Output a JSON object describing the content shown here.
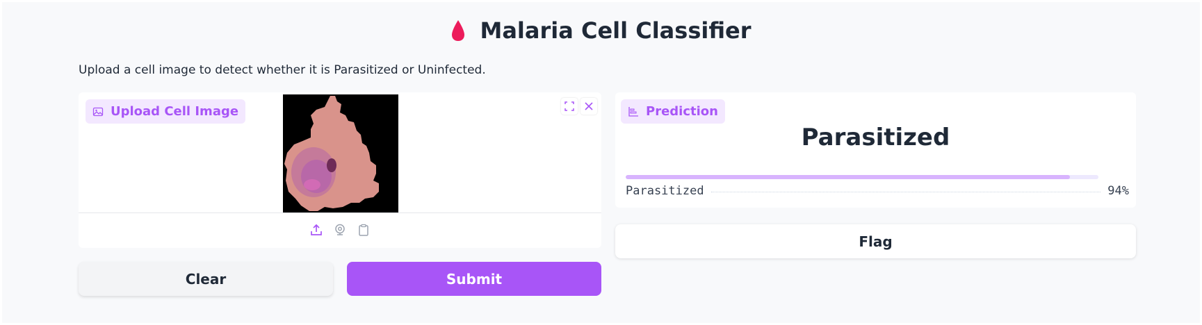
{
  "app": {
    "title": "Malaria Cell Classifier",
    "description": "Upload a cell image to detect whether it is Parasitized or Uninfected."
  },
  "input_panel": {
    "label": "Upload Cell Image",
    "icons": [
      "fullscreen-icon",
      "close-icon",
      "upload-icon",
      "webcam-icon",
      "clipboard-icon"
    ]
  },
  "actions": {
    "clear_label": "Clear",
    "submit_label": "Submit",
    "flag_label": "Flag"
  },
  "output_panel": {
    "label": "Prediction",
    "predicted_class": "Parasitized",
    "confidences": [
      {
        "label": "Parasitized",
        "percent_text": "94%",
        "fraction": 0.94
      }
    ]
  },
  "colors": {
    "accent": "#a855f7",
    "chip_bg": "#f3e8ff",
    "drop": "#ec1c5b"
  }
}
